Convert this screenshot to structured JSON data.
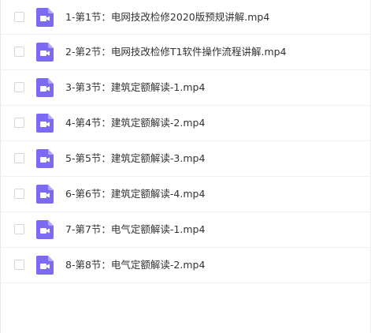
{
  "files": [
    {
      "name": "1-第1节：电网技改检修2020版预规讲解.mp4",
      "icon": "video-file-icon"
    },
    {
      "name": "2-第2节：电网技改检修T1软件操作流程讲解.mp4",
      "icon": "video-file-icon"
    },
    {
      "name": "3-第3节：建筑定额解读-1.mp4",
      "icon": "video-file-icon"
    },
    {
      "name": "4-第4节：建筑定额解读-2.mp4",
      "icon": "video-file-icon"
    },
    {
      "name": "5-第5节：建筑定额解读-3.mp4",
      "icon": "video-file-icon"
    },
    {
      "name": "6-第6节：建筑定额解读-4.mp4",
      "icon": "video-file-icon"
    },
    {
      "name": "7-第7节：电气定额解读-1.mp4",
      "icon": "video-file-icon"
    },
    {
      "name": "8-第8节：电气定额解读-2.mp4",
      "icon": "video-file-icon"
    }
  ],
  "colors": {
    "icon_fill": "#7c6af2",
    "icon_fold": "#b3a8f7",
    "text": "#333333",
    "row_border": "#f0f0f0",
    "checkbox_border": "#d6d6d6"
  }
}
